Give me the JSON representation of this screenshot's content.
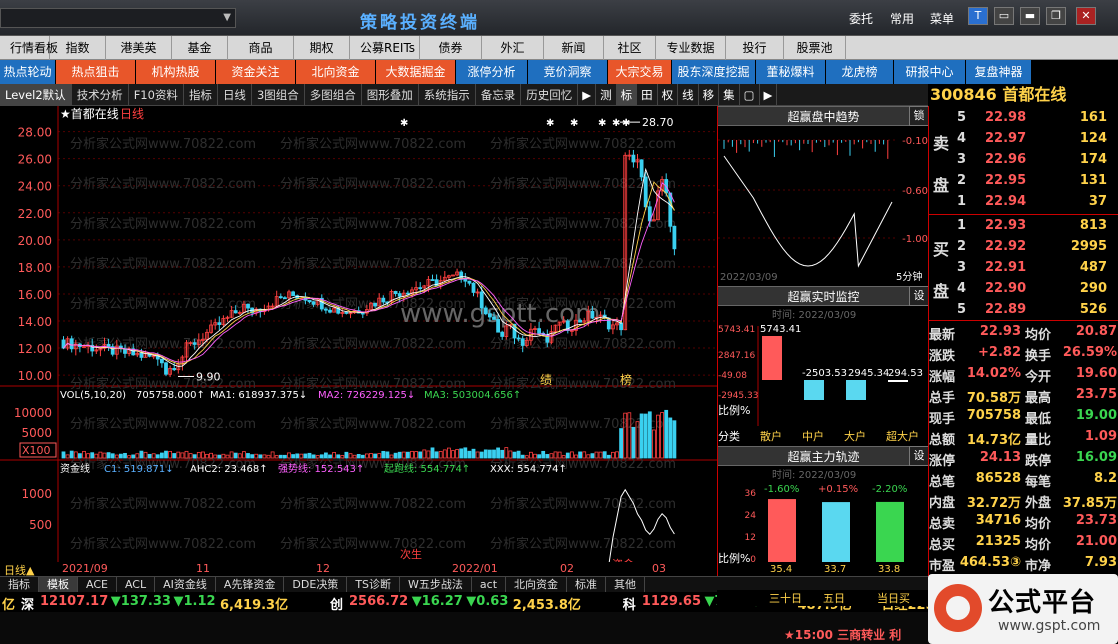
{
  "titlebar": {
    "app_title": "策略投资终端",
    "links": [
      "委托",
      "常用",
      "菜单"
    ],
    "window_buttons": [
      "T",
      "▭",
      "▬",
      "❐",
      "✕"
    ]
  },
  "menu1": [
    "行情看板",
    "指数",
    "港美英",
    "基金",
    "商品",
    "期权",
    "公募REITs",
    "债券",
    "外汇",
    "新闻",
    "社区",
    "专业数据",
    "投行",
    "股票池"
  ],
  "menu2": [
    {
      "label": "热点轮动",
      "color": "#1f6fbf"
    },
    {
      "label": "热点狙击",
      "color": "#e8562a"
    },
    {
      "label": "机构热股",
      "color": "#e8562a"
    },
    {
      "label": "资金关注",
      "color": "#e8562a"
    },
    {
      "label": "北向资金",
      "color": "#e8562a"
    },
    {
      "label": "大数据掘金",
      "color": "#e8562a"
    },
    {
      "label": "涨停分析",
      "color": "#1f6fbf"
    },
    {
      "label": "竞价洞察",
      "color": "#1f6fbf"
    },
    {
      "label": "大宗交易",
      "color": "#e8562a"
    },
    {
      "label": "股东深度挖掘",
      "color": "#1f6fbf"
    },
    {
      "label": "董秘爆料",
      "color": "#1f6fbf"
    },
    {
      "label": "龙虎榜",
      "color": "#1f6fbf"
    },
    {
      "label": "研报中心",
      "color": "#1f6fbf"
    },
    {
      "label": "复盘神器",
      "color": "#1f6fbf"
    }
  ],
  "toolbar": [
    "Level2默认",
    "技术分析",
    "F10资料",
    "指标",
    "日线",
    "3图组合",
    "多图组合",
    "图形叠加",
    "系统指示",
    "备忘录",
    "历史回忆"
  ],
  "toolbar_tabs": [
    "▶",
    "测",
    "标",
    "田",
    "权",
    "线",
    "移",
    "集",
    "▢",
    "▶"
  ],
  "stock": {
    "code": "300846",
    "name": "首都在线",
    "period": "日线"
  },
  "main_chart": {
    "label": "★首都在线",
    "period_label": "日线",
    "y_ticks": [
      "28.00",
      "26.00",
      "24.00",
      "22.00",
      "20.00",
      "18.00",
      "16.00",
      "14.00",
      "12.00",
      "10.00"
    ],
    "high_label": "28.70",
    "low_label": "9.90",
    "markers": [
      "绩",
      "榜"
    ],
    "watermarks": [
      "分析家公式网www.70822.com",
      "www.gsptt.com"
    ]
  },
  "vol_pane": {
    "title": "VOL(5,10,20)",
    "vol": "705758.000↑",
    "ma1": "MA1: 618937.375↓",
    "ma2": "MA2: 726229.125↓",
    "ma3": "MA3: 503004.656↑",
    "y_ticks": [
      "10000",
      "5000"
    ],
    "unit": "X100"
  },
  "fund_pane": {
    "title": "资金线",
    "c1": "C1: 519.871↓",
    "ahc2": "AHC2: 23.468↑",
    "qsx": "强势线: 152.543↑",
    "qpx": "起跑线: 554.774↑",
    "xxx": "XXX: 554.774↑",
    "y_ticks": [
      "1000",
      "500"
    ],
    "labels": [
      "次生",
      "资金"
    ]
  },
  "time_axis": [
    "日线▲",
    "2021/09",
    "11",
    "12",
    "2022/01",
    "02",
    "03"
  ],
  "trend_panel": {
    "title": "超赢盘中趋势",
    "btn": "锁",
    "y_ticks": [
      "-0.10",
      "-0.60",
      "-1.00"
    ],
    "date": "2022/03/09",
    "period": "5分钟"
  },
  "realtime_panel": {
    "title": "超赢实时监控",
    "btn": "设",
    "time": "时间: 2022/03/09",
    "y_ticks": [
      "5743.41",
      "2847.16",
      "-49.08",
      "-2945.33"
    ],
    "value_label": "5743.41",
    "bar_values": [
      "-2503.53",
      "2945.34",
      "294.53"
    ],
    "ratio_label": "比例%",
    "categories": [
      "分类",
      "散户",
      "中户",
      "大户",
      "超大户"
    ]
  },
  "main_track_panel": {
    "title": "超赢主力轨迹",
    "btn": "设",
    "time": "时间: 2022/03/09",
    "y_ticks": [
      "36",
      "24",
      "12",
      "0"
    ],
    "bars": [
      {
        "pct": "-1.60%",
        "val": 35.4,
        "color": "#ff5a5a"
      },
      {
        "pct": "+0.15%",
        "val": 33.7,
        "color": "#5ad8f0"
      },
      {
        "pct": "-2.20%",
        "val": 33.8,
        "color": "#3ad650"
      }
    ],
    "ratio_label": "比例%",
    "periods": [
      "三十日",
      "五日",
      "当日买"
    ]
  },
  "quote": {
    "sell": [
      {
        "lv": "5",
        "price": "22.98",
        "vol": "161"
      },
      {
        "lv": "4",
        "price": "22.97",
        "vol": "124"
      },
      {
        "lv": "3",
        "price": "22.96",
        "vol": "174"
      },
      {
        "lv": "2",
        "price": "22.95",
        "vol": "131"
      },
      {
        "lv": "1",
        "price": "22.94",
        "vol": "37"
      }
    ],
    "buy": [
      {
        "lv": "1",
        "price": "22.93",
        "vol": "813"
      },
      {
        "lv": "2",
        "price": "22.92",
        "vol": "2995"
      },
      {
        "lv": "3",
        "price": "22.91",
        "vol": "487"
      },
      {
        "lv": "4",
        "price": "22.90",
        "vol": "290"
      },
      {
        "lv": "5",
        "price": "22.89",
        "vol": "526"
      }
    ],
    "sell_side": [
      "卖",
      "盘"
    ],
    "buy_side": [
      "买",
      "盘"
    ],
    "stats": [
      [
        "最新",
        "22.93",
        "均价",
        "20.87"
      ],
      [
        "涨跌",
        "+2.82",
        "换手",
        "26.59%"
      ],
      [
        "涨幅",
        "14.02%",
        "今开",
        "19.60"
      ],
      [
        "总手",
        "70.58万",
        "最高",
        "23.75"
      ],
      [
        "现手",
        "705758",
        "最低",
        "19.00"
      ],
      [
        "总额",
        "14.73亿",
        "量比",
        "1.09"
      ],
      [
        "涨停",
        "24.13",
        "跌停",
        "16.09"
      ],
      [
        "总笔",
        "86528",
        "每笔",
        "8.2"
      ],
      [
        "内盘",
        "32.72万",
        "外盘",
        "37.85万"
      ],
      [
        "总卖",
        "34716",
        "均价",
        "23.73"
      ],
      [
        "总买",
        "21325",
        "均价",
        "21.00"
      ],
      [
        "市盈",
        "464.53③",
        "市净",
        "7.93"
      ],
      [
        "总值",
        "106.9亿",
        "流值",
        "60.87亿"
      ]
    ]
  },
  "bottom_tabs": [
    "指标",
    "模板",
    "ACE",
    "ACL",
    "AI资金线",
    "A先锋资金",
    "DDE决策",
    "TS诊断",
    "W五步战法",
    "act",
    "北向资金",
    "标准",
    "其他"
  ],
  "ticker": [
    {
      "t": "亿",
      "c": "#ffd24a"
    },
    {
      "t": "深",
      "c": "#fff"
    },
    {
      "t": "12107.17",
      "c": "#ff5a5a"
    },
    {
      "t": "▼137.33",
      "c": "#3ad650"
    },
    {
      "t": "▼1.12",
      "c": "#3ad650"
    },
    {
      "t": "6,419.3亿",
      "c": "#ffd24a"
    },
    {
      "t": "创",
      "c": "#fff"
    },
    {
      "t": "2566.72",
      "c": "#ff5a5a"
    },
    {
      "t": "▼16.27",
      "c": "#3ad650"
    },
    {
      "t": "▼0.63",
      "c": "#3ad650"
    },
    {
      "t": "2,453.8亿",
      "c": "#ffd24a"
    },
    {
      "t": "科",
      "c": "#fff"
    },
    {
      "t": "1129.65",
      "c": "#ff5a5a"
    },
    {
      "t": "▼7.42",
      "c": "#3ad650"
    },
    {
      "t": "▼0.65",
      "c": "#3ad650"
    },
    {
      "t": "487.9亿",
      "c": "#ffd24a"
    },
    {
      "t": "日经225指数",
      "c": "#ffd24a"
    }
  ],
  "ticker2_right": "★15:00 三商转业 利",
  "watermark_logo": {
    "text": "公式平台",
    "url": "www.gspt.com"
  }
}
